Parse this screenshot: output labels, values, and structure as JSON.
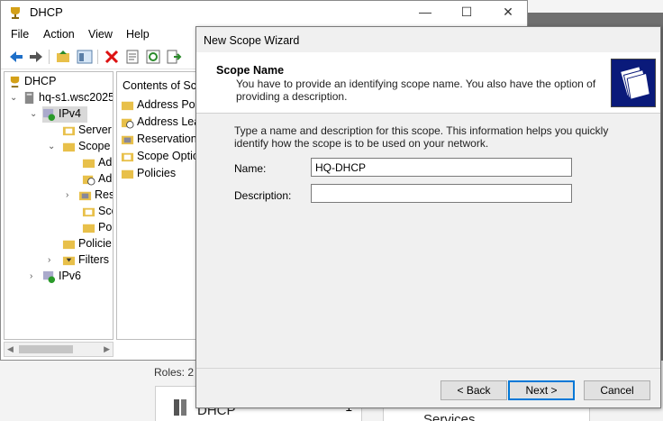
{
  "window": {
    "title": "DHCP"
  },
  "menu": [
    "File",
    "Action",
    "View",
    "Help"
  ],
  "tree": {
    "root": "DHCP",
    "server": "hq-s1.wsc2025",
    "ipv4": "IPv4",
    "server_options": "Server",
    "scope": "Scope",
    "scope_children": [
      "Ad",
      "Ad",
      "Res",
      "Sco",
      "Pol"
    ],
    "policies": "Policie",
    "filters": "Filters",
    "ipv6": "IPv6"
  },
  "content": {
    "header": "Contents of Sco",
    "items": [
      "Address Poo",
      "Address Leas",
      "Reservations",
      "Scope Optio",
      "Policies"
    ]
  },
  "background": {
    "roles_label": "Roles: 2",
    "tile_dhcp": "DHCP",
    "tile_dhcp_count": "1",
    "tile_services": "Services"
  },
  "wizard": {
    "title": "New Scope Wizard",
    "heading": "Scope Name",
    "subtitle": "You have to provide an identifying scope name. You also have the option of providing a description.",
    "intro": "Type a name and description for this scope. This information helps you quickly identify how the scope is to be used on your network.",
    "name_label": "Name:",
    "name_value": "HQ-DHCP",
    "description_label": "Description:",
    "description_value": "",
    "back_label": "< Back",
    "next_label": "Next >",
    "cancel_label": "Cancel"
  },
  "colors": {
    "accent": "#0078d7",
    "header_graphic": "#0a1a7a"
  }
}
